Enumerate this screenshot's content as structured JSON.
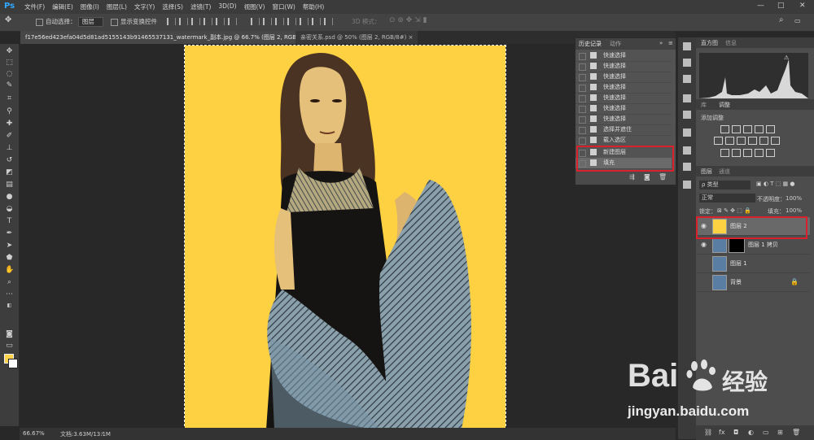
{
  "menubar": {
    "logo": "Ps",
    "items": [
      "文件(F)",
      "编辑(E)",
      "图像(I)",
      "图层(L)",
      "文字(Y)",
      "选择(S)",
      "滤镜(T)",
      "3D(D)",
      "视图(V)",
      "窗口(W)",
      "帮助(H)"
    ],
    "min": "—",
    "max": "□",
    "close": "✕"
  },
  "options": {
    "auto_select_label": "自动选择：",
    "auto_select_value": "图层",
    "show_transform_label": "显示变换控件",
    "mode_3d_label": "3D 模式："
  },
  "tabs": [
    {
      "label": "f17e56ed423efa04d5d81ad5155143b91465537131_watermark_副本.jpg @ 66.7% (图层 2, RGB/8#) *"
    },
    {
      "label": "亲密关系.psd @ 50% (图层 2, RGB/8#)"
    }
  ],
  "status": {
    "zoom": "66.67%",
    "doc": "文档:3.63M/13.1M"
  },
  "history": {
    "tabs": [
      "历史记录",
      "动作"
    ],
    "items": [
      "快速选择",
      "快速选择",
      "快速选择",
      "快速选择",
      "快速选择",
      "快速选择",
      "快速选择",
      "选择并遮住",
      "载入选区",
      "新建图层",
      "填充"
    ]
  },
  "histogram": {
    "tabs": [
      "直方图",
      "信息"
    ]
  },
  "adjustments": {
    "tabs": [
      "库",
      "调整"
    ],
    "add_label": "添加调整"
  },
  "layers": {
    "tabs": [
      "图层",
      "通道"
    ],
    "filter_label": "ρ 类型",
    "blend_mode": "正常",
    "opacity_label": "不透明度：",
    "opacity_value": "100%",
    "lock_label": "锁定：",
    "fill_label": "填充：",
    "fill_value": "100%",
    "items": [
      {
        "name": "图层 2",
        "thumb_color": "#fdd142"
      },
      {
        "name": "图层 1 拷贝",
        "thumb_color": "#5a7da3"
      },
      {
        "name": "图层 1",
        "thumb_color": "#5a7da3"
      },
      {
        "name": "背景",
        "thumb_color": "#5a7da3"
      }
    ]
  },
  "watermark": {
    "brand": "Bai",
    "brand2": "经验",
    "url": "jingyan.baidu.com"
  },
  "colors": {
    "accent": "#d9212b",
    "canvas": "#fdd142",
    "ps_blue": "#31a8ff"
  }
}
